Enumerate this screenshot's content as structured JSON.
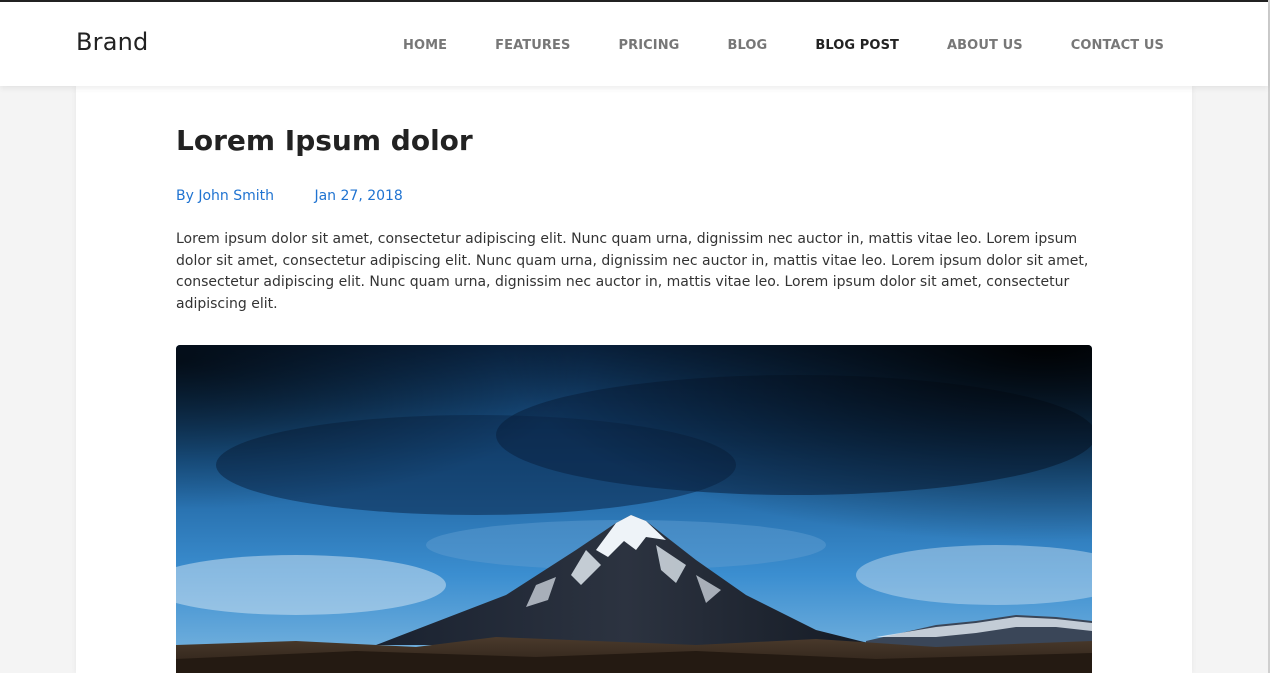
{
  "nav": {
    "brand": "Brand",
    "items": [
      {
        "label": "HOME"
      },
      {
        "label": "FEATURES"
      },
      {
        "label": "PRICING"
      },
      {
        "label": "BLOG"
      },
      {
        "label": "BLOG POST",
        "active": true
      },
      {
        "label": "ABOUT US"
      },
      {
        "label": "CONTACT US"
      }
    ]
  },
  "post": {
    "title": "Lorem Ipsum dolor",
    "author": "By John Smith",
    "date": "Jan 27, 2018",
    "body": "Lorem ipsum dolor sit amet, consectetur adipiscing elit. Nunc quam urna, dignissim nec auctor in, mattis vitae leo. Lorem ipsum dolor sit amet, consectetur adipiscing elit. Nunc quam urna, dignissim nec auctor in, mattis vitae leo. Lorem ipsum dolor sit amet, consectetur adipiscing elit. Nunc quam urna, dignissim nec auctor in, mattis vitae leo. Lorem ipsum dolor sit amet, consectetur adipiscing elit."
  },
  "colors": {
    "link": "#1f73d1",
    "nav_text": "#777777",
    "nav_active": "#222222"
  }
}
